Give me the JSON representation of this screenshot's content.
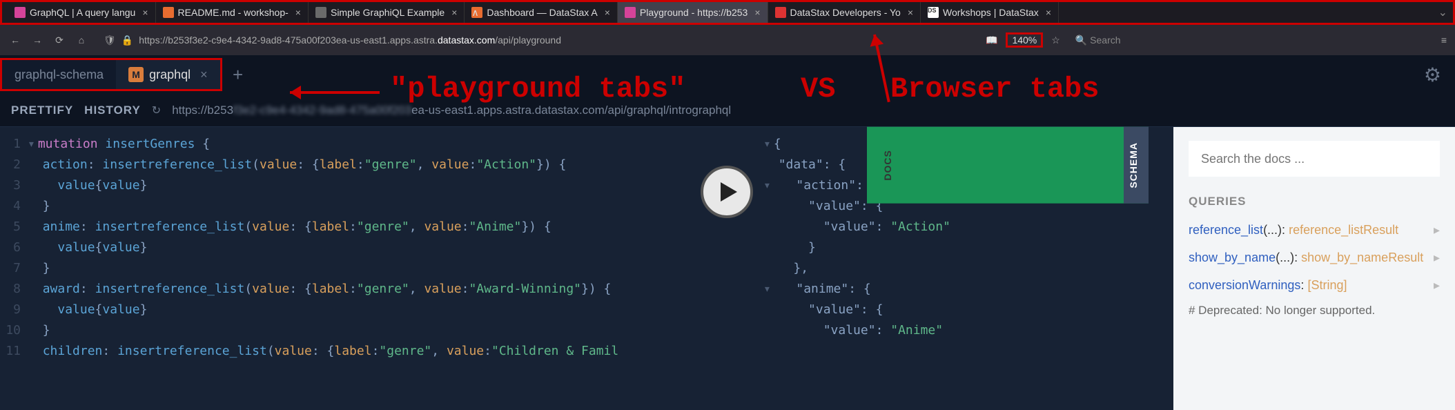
{
  "browser": {
    "tabs": [
      {
        "label": "GraphQL | A query langu",
        "favicon": "#d54399"
      },
      {
        "label": "README.md - workshop-",
        "favicon": "#e86c30"
      },
      {
        "label": "Simple GraphiQL Example",
        "favicon": "#6a6a6a"
      },
      {
        "label": "Dashboard — DataStax A",
        "favicon": "#e86c30"
      },
      {
        "label": "Playground - https://b253",
        "favicon": "#d54399",
        "active": true
      },
      {
        "label": "DataStax Developers - Yo",
        "favicon": "#d33"
      },
      {
        "label": "Workshops | DataStax",
        "favicon": "#fff"
      }
    ],
    "url_pre": "https://b253f3e2-c9e4-4342-9ad8-475a00f203ea-us-east1.apps.astra.",
    "url_hl": "datastax.com",
    "url_post": "/api/playground",
    "zoom": "140%",
    "search_placeholder": "Search"
  },
  "playground": {
    "tabs": [
      {
        "label": "graphql-schema"
      },
      {
        "label": "graphql",
        "badge": "M",
        "active": true
      }
    ],
    "toolbar": {
      "prettify": "PRETTIFY",
      "history": "HISTORY",
      "url_pre": "https://b253",
      "url_post": "ea-us-east1.apps.astra.datastax.com/api/graphql/intrographql"
    },
    "code_lines": [
      "▾ mutation insertGenres {",
      "    action: insertreference_list(value: {label:\"genre\", value:\"Action\"}) {",
      "      value{value}",
      "    }",
      "    anime: insertreference_list(value: {label:\"genre\", value:\"Anime\"}) {",
      "      value{value}",
      "    }",
      "    award: insertreference_list(value: {label:\"genre\", value:\"Award-Winning\"}) {",
      "      value{value}",
      "    }",
      "    children: insertreference_list(value: {label:\"genre\", value:\"Children & Famil"
    ],
    "response_lines": [
      "▾ {",
      "    \"data\": {",
      "      \"action\": {",
      "        \"value\": {",
      "          \"value\": \"Action\"",
      "        }",
      "      },",
      "      \"anime\": {",
      "        \"value\": {",
      "          \"value\": \"Anime\""
    ],
    "side": {
      "docs": "DOCS",
      "schema": "SCHEMA"
    }
  },
  "docs": {
    "search_placeholder": "Search the docs ...",
    "header": "QUERIES",
    "queries": [
      {
        "name": "reference_list",
        "args": "(...):",
        "ret": "reference_listResult"
      },
      {
        "name": "show_by_name",
        "args": "(...):",
        "ret": "show_by_nameResult"
      },
      {
        "name": "conversionWarnings",
        "args": ":",
        "ret": "[String]"
      }
    ],
    "deprecated": "# Deprecated: No longer supported."
  },
  "annotations": {
    "left": "\"playground tabs\"",
    "vs": "VS",
    "right": "Browser tabs"
  }
}
